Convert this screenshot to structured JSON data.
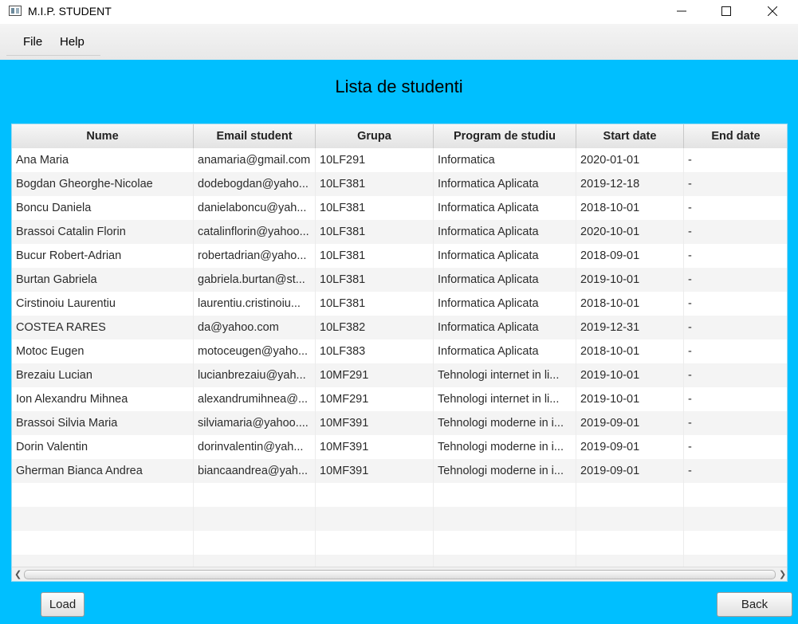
{
  "window": {
    "title": "M.I.P. STUDENT"
  },
  "menu": {
    "file": "File",
    "help": "Help"
  },
  "page": {
    "title": "Lista de studenti"
  },
  "table": {
    "columns": [
      "Nume",
      "Email student",
      "Grupa",
      "Program de studiu",
      "Start date",
      "End date"
    ],
    "rows": [
      [
        "Ana Maria",
        "anamaria@gmail.com",
        "10LF291",
        "Informatica",
        "2020-01-01",
        "-"
      ],
      [
        "Bogdan Gheorghe-Nicolae",
        "dodebogdan@yaho...",
        "10LF381",
        "Informatica Aplicata",
        "2019-12-18",
        "-"
      ],
      [
        "Boncu Daniela",
        "danielaboncu@yah...",
        "10LF381",
        "Informatica Aplicata",
        "2018-10-01",
        "-"
      ],
      [
        "Brassoi Catalin Florin",
        "catalinflorin@yahoo...",
        "10LF381",
        "Informatica Aplicata",
        "2020-10-01",
        "-"
      ],
      [
        "Bucur Robert-Adrian",
        "robertadrian@yaho...",
        "10LF381",
        "Informatica Aplicata",
        "2018-09-01",
        "-"
      ],
      [
        "Burtan Gabriela",
        "gabriela.burtan@st...",
        "10LF381",
        "Informatica Aplicata",
        "2019-10-01",
        "-"
      ],
      [
        "Cirstinoiu Laurentiu",
        "laurentiu.cristinoiu...",
        "10LF381",
        "Informatica Aplicata",
        "2018-10-01",
        "-"
      ],
      [
        "COSTEA RARES",
        "da@yahoo.com",
        "10LF382",
        "Informatica Aplicata",
        "2019-12-31",
        "-"
      ],
      [
        "Motoc Eugen",
        "motoceugen@yaho...",
        "10LF383",
        "Informatica Aplicata",
        "2018-10-01",
        "-"
      ],
      [
        "Brezaiu Lucian",
        "lucianbrezaiu@yah...",
        "10MF291",
        "Tehnologi internet in li...",
        "2019-10-01",
        "-"
      ],
      [
        "Ion Alexandru Mihnea",
        "alexandrumihnea@...",
        "10MF291",
        "Tehnologi internet in li...",
        "2019-10-01",
        "-"
      ],
      [
        "Brassoi Silvia Maria",
        "silviamaria@yahoo....",
        "10MF391",
        "Tehnologi moderne in i...",
        "2019-09-01",
        "-"
      ],
      [
        "Dorin Valentin",
        "dorinvalentin@yah...",
        "10MF391",
        "Tehnologi moderne in i...",
        "2019-09-01",
        "-"
      ],
      [
        "Gherman Bianca Andrea",
        "biancaandrea@yah...",
        "10MF391",
        "Tehnologi moderne in i...",
        "2019-09-01",
        "-"
      ]
    ],
    "empty_rows": 4
  },
  "buttons": {
    "load": "Load",
    "back": "Back"
  },
  "colors": {
    "background": "#00bfff"
  }
}
